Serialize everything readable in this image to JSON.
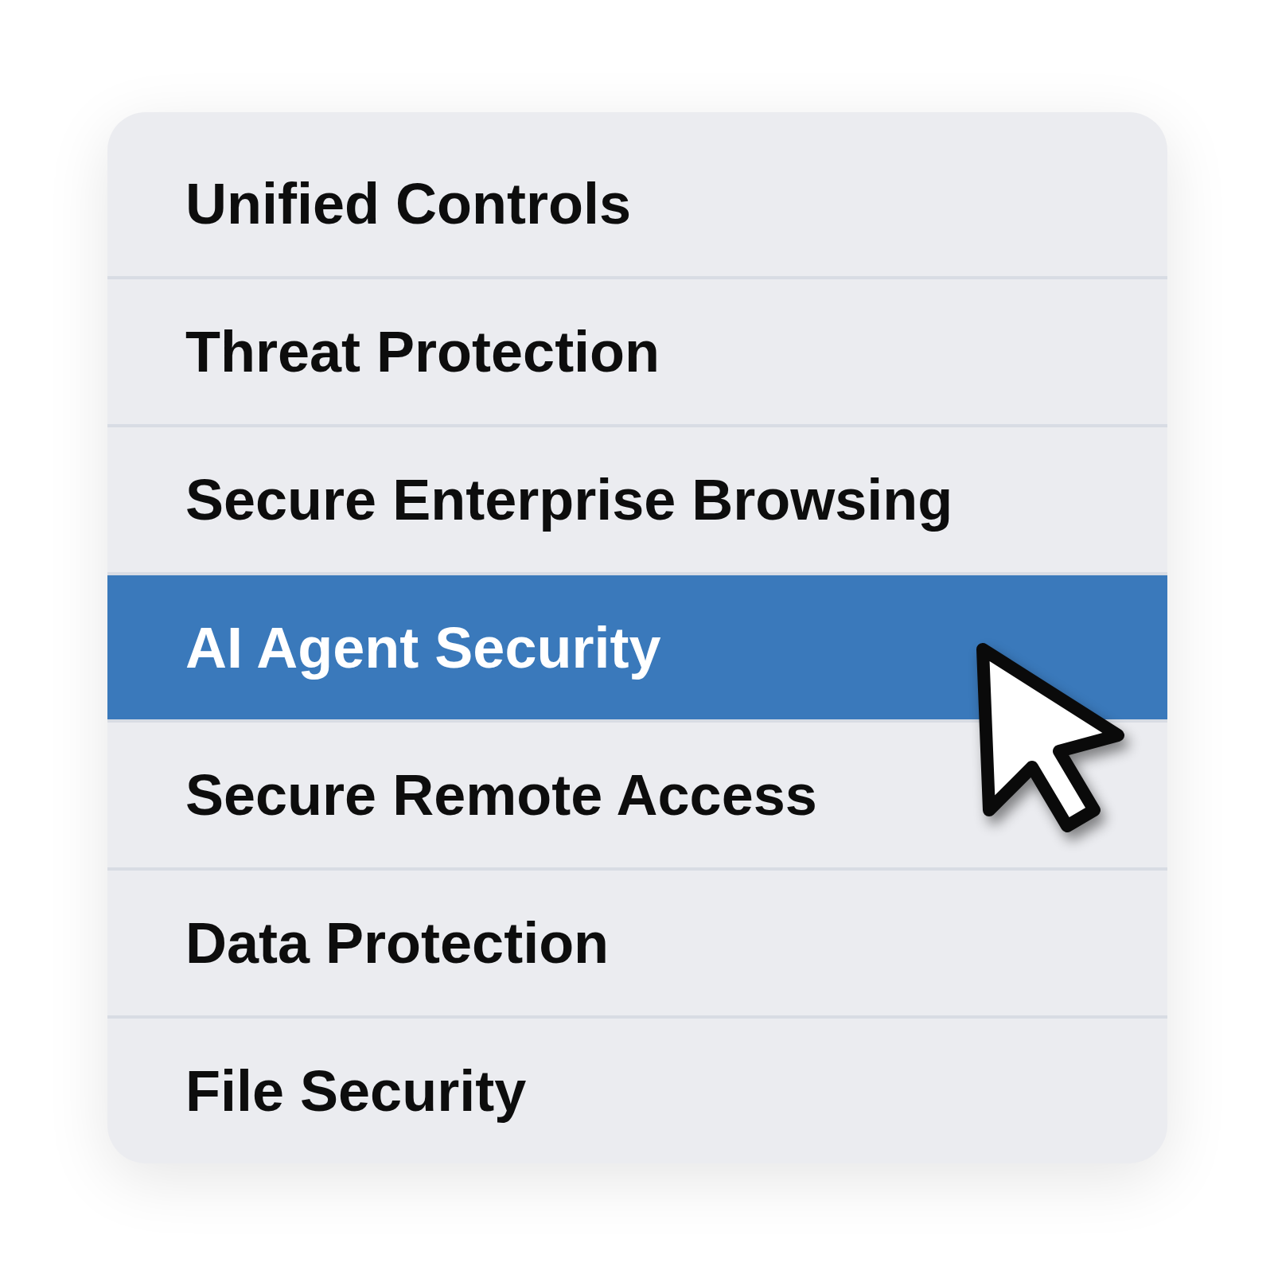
{
  "menu": {
    "items": [
      {
        "label": "Unified Controls",
        "selected": false
      },
      {
        "label": "Threat Protection",
        "selected": false
      },
      {
        "label": "Secure Enterprise Browsing",
        "selected": false
      },
      {
        "label": "AI Agent Security",
        "selected": true
      },
      {
        "label": "Secure Remote Access",
        "selected": false
      },
      {
        "label": "Data Protection",
        "selected": false
      },
      {
        "label": "File Security",
        "selected": false
      }
    ]
  }
}
